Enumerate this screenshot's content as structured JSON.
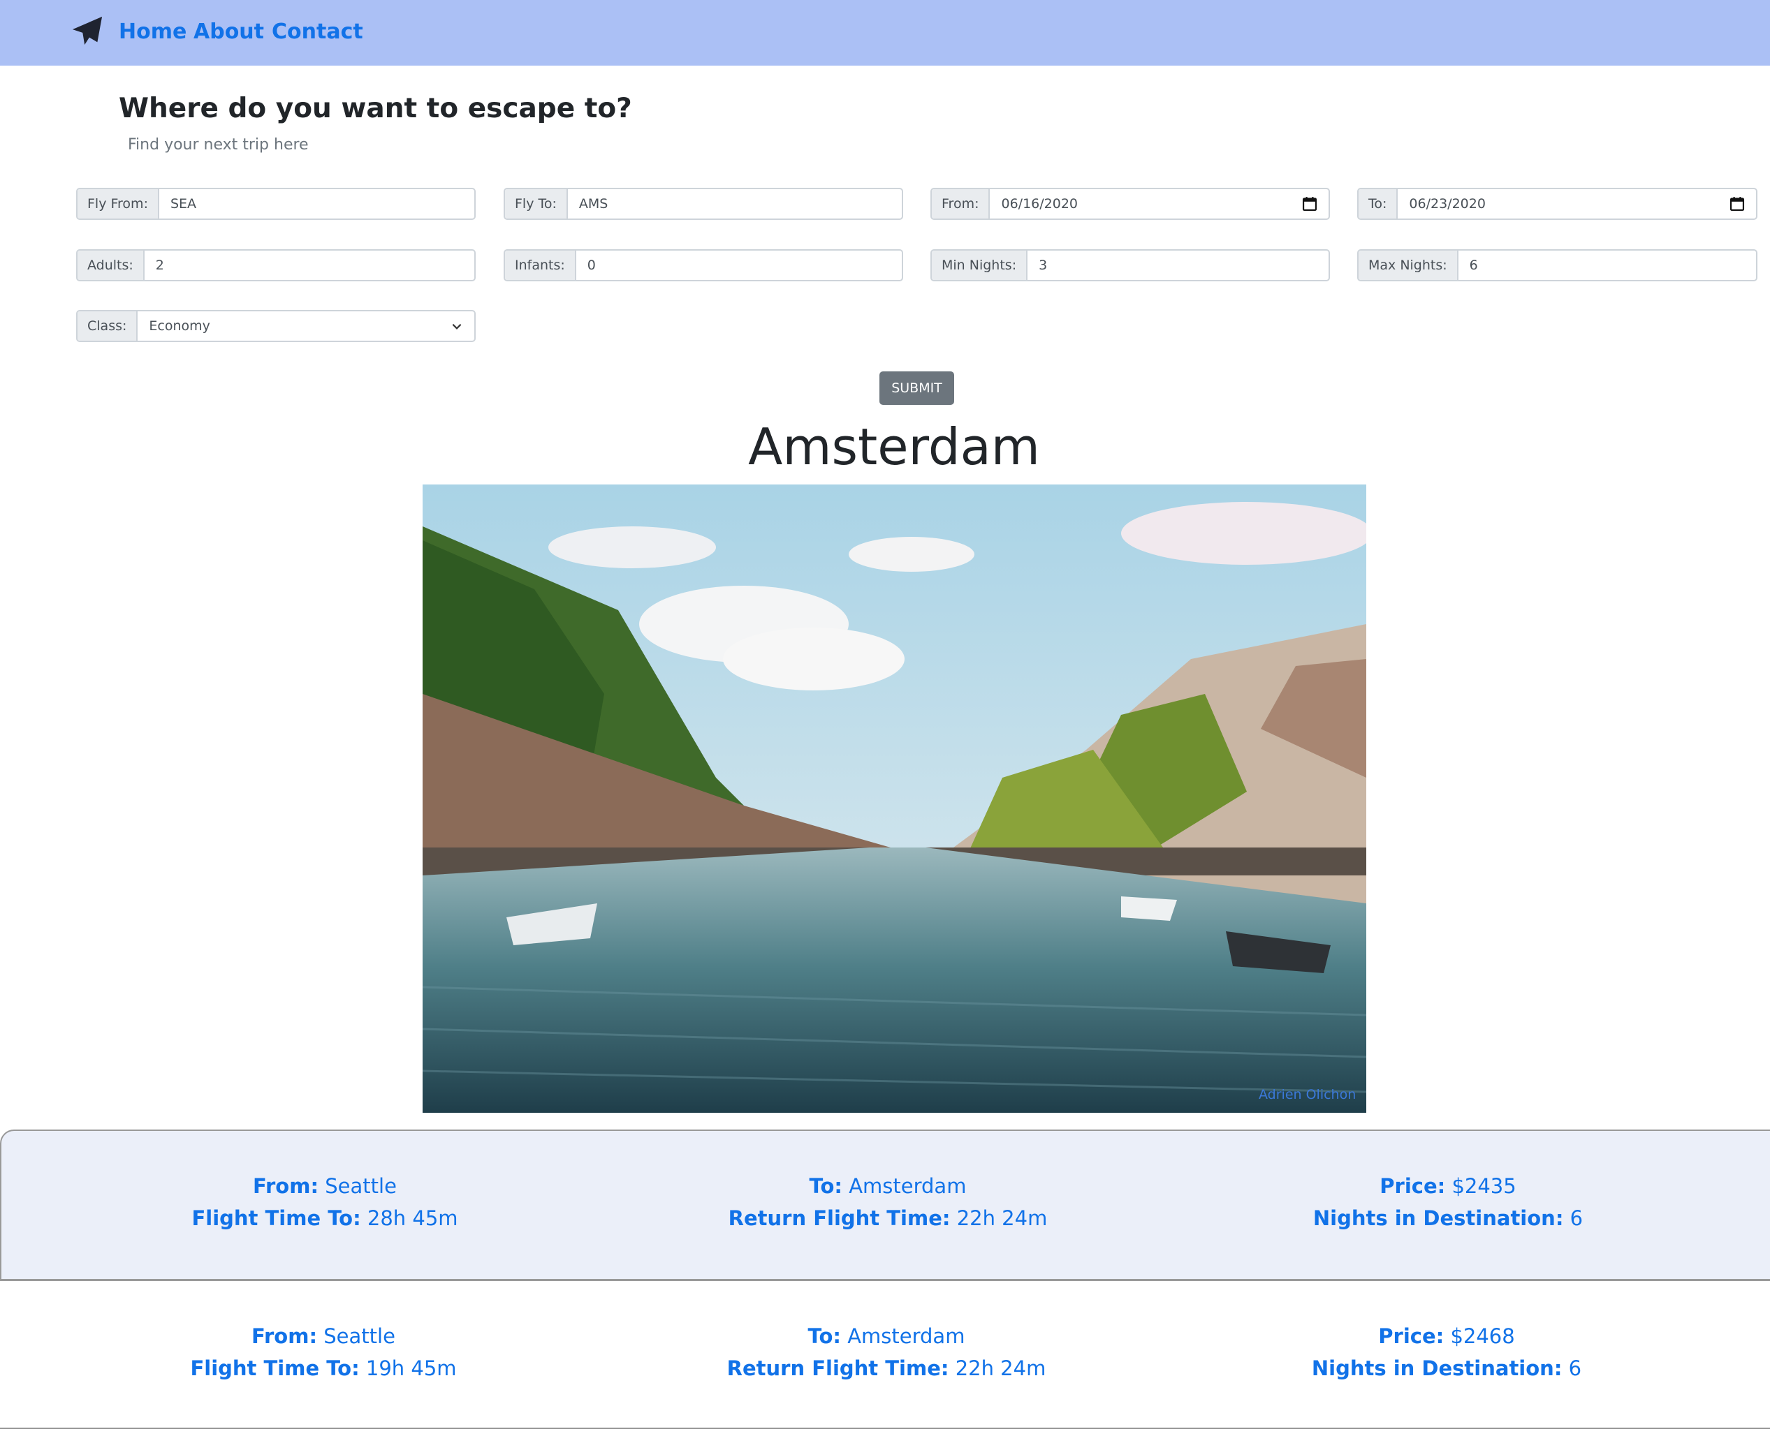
{
  "nav": {
    "brand_icon": "paper-plane-icon",
    "links": [
      "Home",
      "About",
      "Contact"
    ]
  },
  "hero": {
    "title": "Where do you want to escape to?",
    "subtitle": "Find your next trip here"
  },
  "form": {
    "fly_from": {
      "label": "Fly From:",
      "value": "SEA"
    },
    "fly_to": {
      "label": "Fly To:",
      "value": "AMS"
    },
    "date_from": {
      "label": "From:",
      "value": "06/16/2020"
    },
    "date_to": {
      "label": "To:",
      "value": "06/23/2020"
    },
    "adults": {
      "label": "Adults:",
      "value": "2"
    },
    "infants": {
      "label": "Infants:",
      "value": "0"
    },
    "min_nights": {
      "label": "Min Nights:",
      "value": "3"
    },
    "max_nights": {
      "label": "Max Nights:",
      "value": "6"
    },
    "class": {
      "label": "Class:",
      "value": "Economy"
    },
    "submit_label": "SUBMIT"
  },
  "destination": {
    "city": "Amsterdam",
    "photo_credit": "Adrien Olichon"
  },
  "labels": {
    "from": "From:",
    "to": "To:",
    "price": "Price:",
    "flight_time_to": "Flight Time To:",
    "return_flight_time": "Return Flight Time:",
    "nights": "Nights in Destination:"
  },
  "results": [
    {
      "from": "Seattle",
      "to": "Amsterdam",
      "price": "$2435",
      "flight_time_to": "28h 45m",
      "return_flight_time": "22h 24m",
      "nights": "6"
    },
    {
      "from": "Seattle",
      "to": "Amsterdam",
      "price": "$2468",
      "flight_time_to": "19h 45m",
      "return_flight_time": "22h 24m",
      "nights": "6"
    }
  ],
  "colors": {
    "navbar": "#abc0f5",
    "link": "#1172e8",
    "result_highlight": "#ebeff9",
    "submit": "#6c757d"
  }
}
